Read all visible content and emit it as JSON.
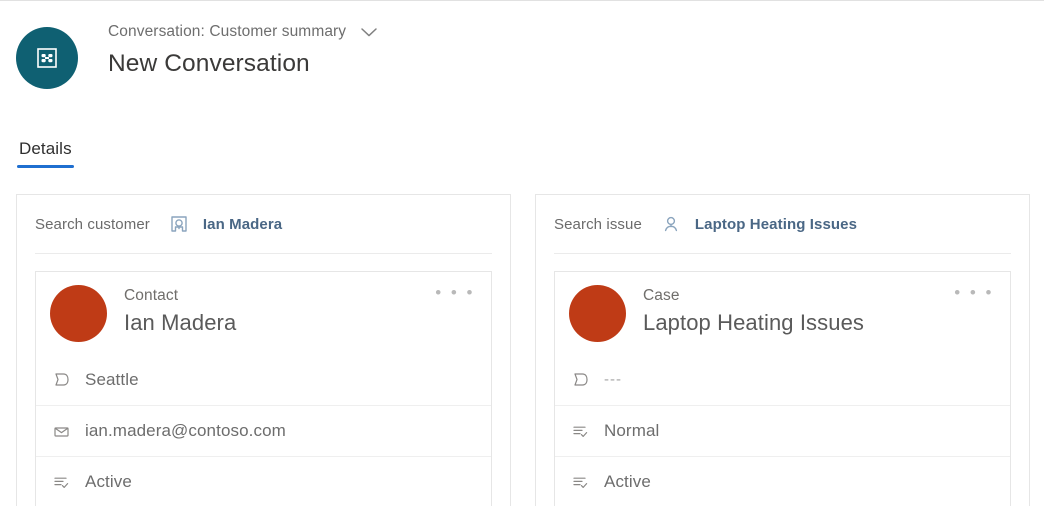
{
  "header": {
    "avatar_icon": "conversation-icon",
    "subtitle": "Conversation: Customer summary",
    "chevron_icon": "chevron-down-icon",
    "title": "New Conversation"
  },
  "tabs": [
    {
      "label": "Details",
      "active": true
    }
  ],
  "colors": {
    "header_avatar": "#0f6072",
    "entity_avatar": "#bf3b16",
    "tab_underline": "#1f6fd0",
    "link": "#4a6785"
  },
  "cards": [
    {
      "search_label": "Search customer",
      "search_icon": "contact-card-icon",
      "search_value": "Ian Madera",
      "entity": {
        "type": "Contact",
        "name": "Ian Madera",
        "more_label": "• • •",
        "fields": [
          {
            "icon": "location-flag-icon",
            "value": "Seattle",
            "muted": false
          },
          {
            "icon": "envelope-icon",
            "value": "ian.madera@contoso.com",
            "muted": false
          },
          {
            "icon": "status-list-icon",
            "value": "Active",
            "muted": false
          }
        ]
      }
    },
    {
      "search_label": "Search issue",
      "search_icon": "person-icon",
      "search_value": "Laptop Heating Issues",
      "entity": {
        "type": "Case",
        "name": "Laptop Heating Issues",
        "more_label": "• • •",
        "fields": [
          {
            "icon": "location-flag-icon",
            "value": "---",
            "muted": true
          },
          {
            "icon": "status-list-icon",
            "value": "Normal",
            "muted": false
          },
          {
            "icon": "status-list-icon",
            "value": "Active",
            "muted": false
          }
        ]
      }
    }
  ]
}
